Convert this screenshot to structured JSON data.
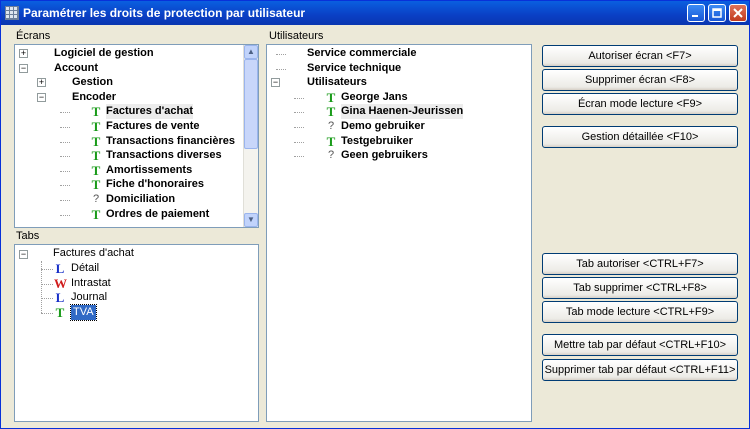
{
  "window": {
    "title": "Paramétrer les droits de protection par utilisateur"
  },
  "labels": {
    "ecrans": "Écrans",
    "tabs": "Tabs",
    "utilisateurs": "Utilisateurs"
  },
  "ecrans": [
    {
      "label": "Logiciel de gestion",
      "level": 0,
      "expander": "+",
      "icon": "",
      "bold": true
    },
    {
      "label": "Account",
      "level": 0,
      "expander": "-",
      "icon": "",
      "bold": true
    },
    {
      "label": "Gestion",
      "level": 1,
      "expander": "+",
      "icon": "",
      "bold": true
    },
    {
      "label": "Encoder",
      "level": 1,
      "expander": "-",
      "icon": "",
      "bold": true
    },
    {
      "label": "Factures d'achat",
      "level": 2,
      "expander": "",
      "icon": "T",
      "bold": true,
      "highlighted": true
    },
    {
      "label": "Factures de vente",
      "level": 2,
      "expander": "",
      "icon": "T",
      "bold": true
    },
    {
      "label": "Transactions financières",
      "level": 2,
      "expander": "",
      "icon": "T",
      "bold": true
    },
    {
      "label": "Transactions diverses",
      "level": 2,
      "expander": "",
      "icon": "T",
      "bold": true
    },
    {
      "label": "Amortissements",
      "level": 2,
      "expander": "",
      "icon": "T",
      "bold": true
    },
    {
      "label": "Fiche d'honoraires",
      "level": 2,
      "expander": "",
      "icon": "T",
      "bold": true
    },
    {
      "label": "Domiciliation",
      "level": 2,
      "expander": "",
      "icon": "?",
      "bold": true
    },
    {
      "label": "Ordres de paiement",
      "level": 2,
      "expander": "",
      "icon": "T",
      "bold": true
    }
  ],
  "tabs_tree": {
    "root": "Factures d'achat",
    "items": [
      {
        "label": "Détail",
        "icon": "L",
        "icon_color": "#1830c8"
      },
      {
        "label": "Intrastat",
        "icon": "W",
        "icon_color": "#d01c1c"
      },
      {
        "label": "Journal",
        "icon": "L",
        "icon_color": "#1830c8"
      },
      {
        "label": "TVA",
        "icon": "T",
        "icon_color": "#1a9b1a",
        "selected": true
      }
    ]
  },
  "utilisateurs": [
    {
      "label": "Service commerciale",
      "level": 0,
      "expander": "",
      "icon": "",
      "bold": true
    },
    {
      "label": "Service technique",
      "level": 0,
      "expander": "",
      "icon": "",
      "bold": true
    },
    {
      "label": "Utilisateurs",
      "level": 0,
      "expander": "-",
      "icon": "",
      "bold": true
    },
    {
      "label": "George Jans",
      "level": 1,
      "expander": "",
      "icon": "T",
      "bold": true
    },
    {
      "label": "Gina Haenen-Jeurissen",
      "level": 1,
      "expander": "",
      "icon": "T",
      "bold": true,
      "highlighted": true
    },
    {
      "label": "Demo gebruiker",
      "level": 1,
      "expander": "",
      "icon": "?",
      "bold": true
    },
    {
      "label": "Testgebruiker",
      "level": 1,
      "expander": "",
      "icon": "T",
      "bold": true
    },
    {
      "label": "Geen gebruikers",
      "level": 1,
      "expander": "",
      "icon": "?",
      "bold": true
    }
  ],
  "buttons": {
    "autoriser_ecran": "Autoriser écran <F7>",
    "supprimer_ecran": "Supprimer écran <F8>",
    "ecran_lecture": "Écran mode lecture <F9>",
    "gestion_detaillee": "Gestion détaillée <F10>",
    "tab_autoriser": "Tab autoriser <CTRL+F7>",
    "tab_supprimer": "Tab supprimer <CTRL+F8>",
    "tab_lecture": "Tab mode lecture <CTRL+F9>",
    "mettre_tab_defaut": "Mettre tab par défaut <CTRL+F10>",
    "supprimer_tab_defaut": "Supprimer tab par défaut <CTRL+F11>"
  },
  "icons": {
    "app": "grid-app-icon",
    "minimize": "minimize-icon",
    "maximize": "maximize-icon",
    "close": "close-icon"
  },
  "colors": {
    "title_bar": "#0a3fc4",
    "selection": "#316ac5",
    "icon_T": "#1a9b1a",
    "icon_W": "#d01c1c",
    "icon_L": "#1830c8"
  }
}
